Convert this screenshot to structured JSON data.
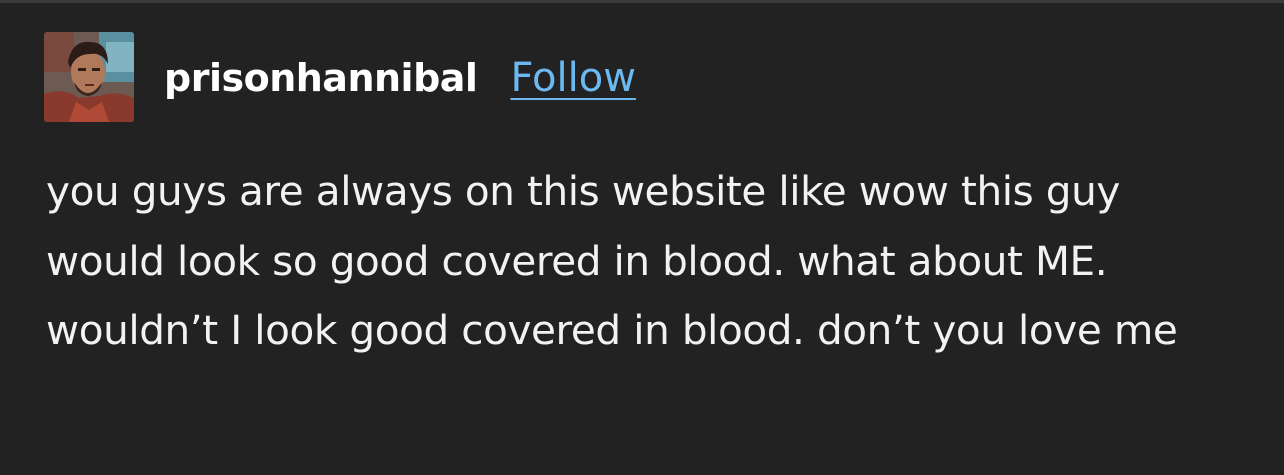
{
  "post": {
    "author": {
      "username": "prisonhannibal",
      "avatar_icon": "avatar-illustrated-man"
    },
    "follow_label": "Follow",
    "body_text": "you guys are always on this website like wow this guy would look so good covered in blood. what about ME. wouldn’t I look good covered in blood. don’t you love me"
  },
  "colors": {
    "background": "#222222",
    "text": "#f2f2f2",
    "username": "#ffffff",
    "follow_link": "#6cb8f0"
  }
}
